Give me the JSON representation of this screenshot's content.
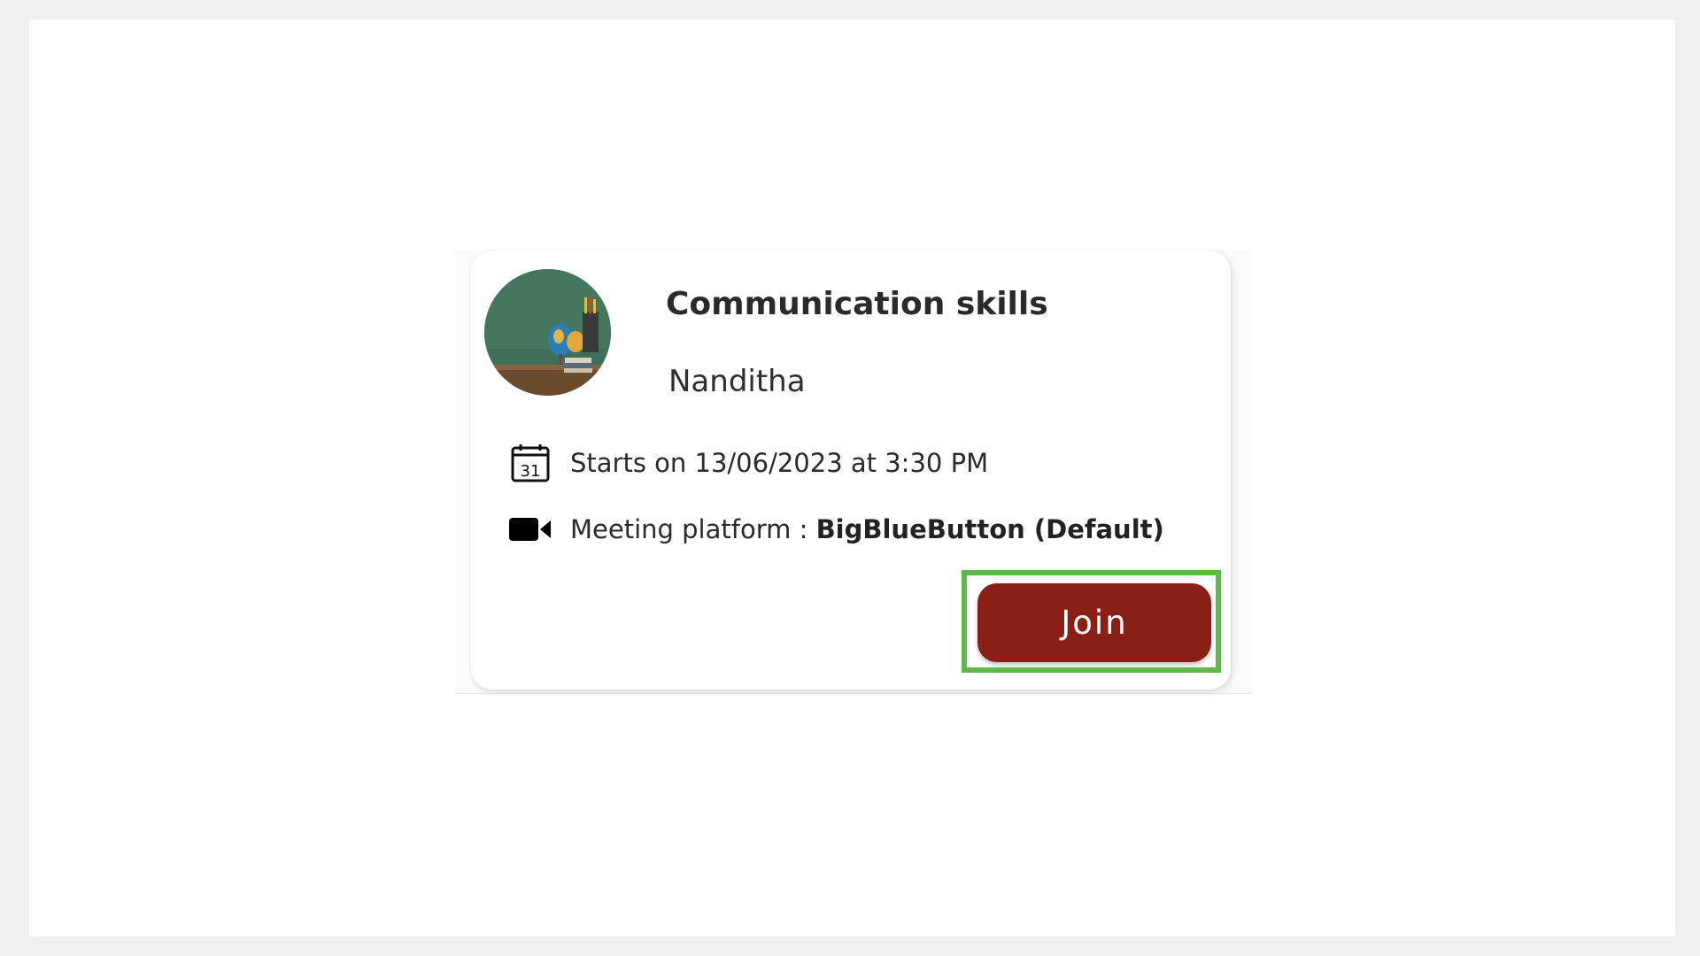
{
  "session_card": {
    "title": "Communication skills",
    "author": "Nanditha",
    "schedule": {
      "icon": "calendar-icon",
      "calendar_day": "31",
      "text": "Starts on 13/06/2023 at 3:30 PM"
    },
    "platform": {
      "icon": "video-camera-icon",
      "label": "Meeting platform : ",
      "value": "BigBlueButton (Default)"
    },
    "join_label": "Join"
  },
  "colors": {
    "join_button": "#8a2015",
    "highlight_border": "#5fb84a",
    "text": "#2a2a2a"
  }
}
